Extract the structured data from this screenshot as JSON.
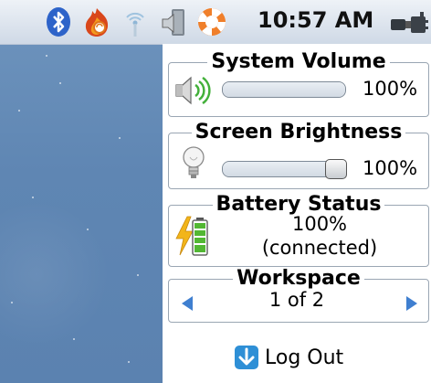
{
  "top_panel": {
    "tray_icons": [
      "bluetooth-icon",
      "update-flame-icon",
      "wireless-icon",
      "volume-tray-icon",
      "help-lifebuoy-icon"
    ],
    "clock": "10:57 AM",
    "power_icon": "power-plug-icon"
  },
  "volume": {
    "title": "System Volume",
    "level": 1.0,
    "percent_label": "100%",
    "icon": "speaker-icon"
  },
  "brightness": {
    "title": "Screen Brightness",
    "level": 1.0,
    "percent_label": "100%",
    "icon": "light-bulb-icon"
  },
  "battery": {
    "title": "Battery Status",
    "percent_label": "100%",
    "status_label": "(connected)",
    "icon": "battery-charging-icon",
    "colors": {
      "bolt": "#f2b51a",
      "cells": "#52b733"
    }
  },
  "workspace": {
    "title": "Workspace",
    "value": "1 of 2",
    "left_icon": "left-arrow-icon",
    "right_icon": "right-arrow-icon",
    "arrow_color": "#3f7fd0"
  },
  "logout": {
    "label": "Log Out",
    "icon": "logout-down-arrow-icon",
    "color": "#2e8fd6"
  }
}
